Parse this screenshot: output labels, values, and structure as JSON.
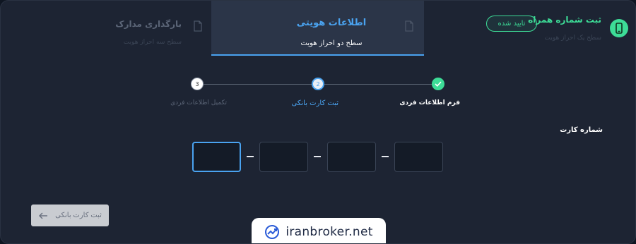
{
  "tabs": [
    {
      "title": "ثبت شماره همراه",
      "subtitle": "سطح یک احراز هویت",
      "badge": "تایید شده",
      "icon": "phone-icon"
    },
    {
      "title": "اطلاعات هویتی",
      "subtitle": "سطح دو احراز هویت",
      "icon": "document-icon"
    },
    {
      "title": "بارگذاری مدارک",
      "subtitle": "سطح سه احراز هویت",
      "icon": "document-icon"
    }
  ],
  "stepper": {
    "steps": [
      {
        "label": "فرم اطلاعات فردی",
        "status": "complete"
      },
      {
        "label": "ثبت کارت بانکی",
        "number": "2",
        "status": "active"
      },
      {
        "label": "تکمیل اطلاعات فردی",
        "number": "3",
        "status": "pending"
      }
    ]
  },
  "card_form": {
    "label": "شماره کارت",
    "boxes": [
      "",
      "",
      "",
      ""
    ]
  },
  "submit": {
    "label": "ثبت کارت بانکی",
    "icon": "arrow-left-icon"
  },
  "watermark": {
    "text": "iranbroker.net"
  },
  "colors": {
    "accent_green": "#3ddc97",
    "accent_blue": "#4aa3f0",
    "background": "#1d2433"
  }
}
